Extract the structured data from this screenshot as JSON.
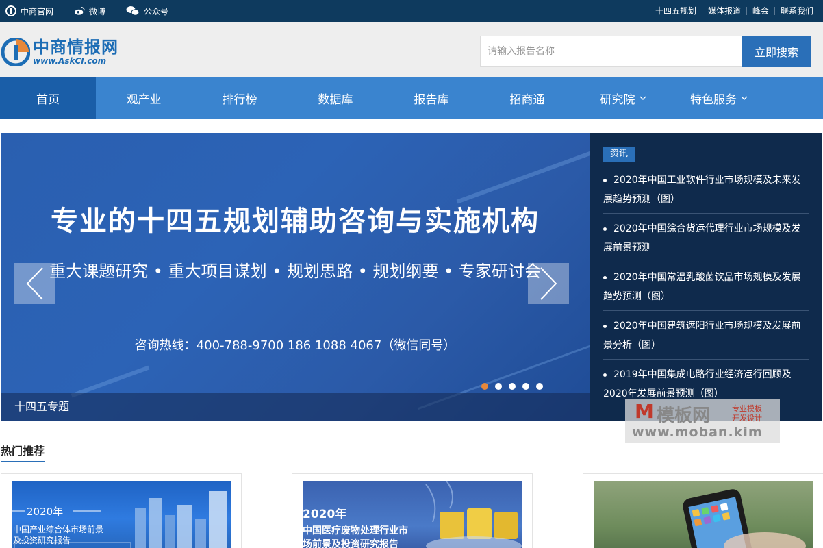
{
  "topbar": {
    "left": [
      {
        "label": "中商官网",
        "icon": "askci-logo-icon"
      },
      {
        "label": "微博",
        "icon": "weibo-icon"
      },
      {
        "label": "公众号",
        "icon": "wechat-icon"
      }
    ],
    "right": [
      "十四五规划",
      "媒体报道",
      "峰会",
      "联系我们"
    ]
  },
  "logo": {
    "cn": "中商情报网",
    "en": "www.AskCI.com"
  },
  "search": {
    "placeholder": "请输入报告名称",
    "button": "立即搜索"
  },
  "nav": [
    {
      "label": "首页",
      "active": true
    },
    {
      "label": "观产业"
    },
    {
      "label": "排行榜"
    },
    {
      "label": "数据库"
    },
    {
      "label": "报告库"
    },
    {
      "label": "招商通"
    },
    {
      "label": "研究院",
      "dropdown": true
    },
    {
      "label": "特色服务",
      "dropdown": true
    }
  ],
  "banner": {
    "headline": "专业的十四五规划辅助咨询与实施机构",
    "sub": "重大课题研究 • 重大项目谋划 • 规划思路 • 规划纲要 • 专家研讨会",
    "hotline": "咨询热线：400-788-9700  186 1088 4067（微信同号）",
    "caption": "十四五专题",
    "slide_count": 5,
    "active_slide": 1
  },
  "news": {
    "tag": "资讯",
    "items": [
      "2020年中国工业软件行业市场规模及未来发展趋势预测（图）",
      "2020年中国综合货运代理行业市场规模及发展前景预测",
      "2020年中国常温乳酸菌饮品市场规模及发展趋势预测（图）",
      "2020年中国建筑遮阳行业市场规模及发展前景分析（图）",
      "2019年中国集成电路行业经济运行回顾及2020年发展前景预测（图）"
    ]
  },
  "watermark": {
    "mark": "M",
    "cn": "模板网",
    "tag1": "专业模板",
    "tag2": "开发设计",
    "url": "www.moban.kim"
  },
  "section": {
    "title": "热门推荐"
  },
  "cards": [
    {
      "year": "2020年",
      "title_line1": "中国产业综合体市场前景",
      "title_line2": "及投资研究报告"
    },
    {
      "year": "2020年",
      "title_line1": "中国医疗废物处理行业市",
      "title_line2": "场前景及投资研究报告"
    },
    {
      "year": "",
      "title_line1": "",
      "title_line2": ""
    }
  ],
  "colors": {
    "topbar": "#0e3a5e",
    "nav": "#3a84cf",
    "nav_active": "#1a5ea8",
    "accent": "#2a6fb8",
    "news_bg": "#0f2a4c",
    "dot_active": "#e8883a"
  }
}
